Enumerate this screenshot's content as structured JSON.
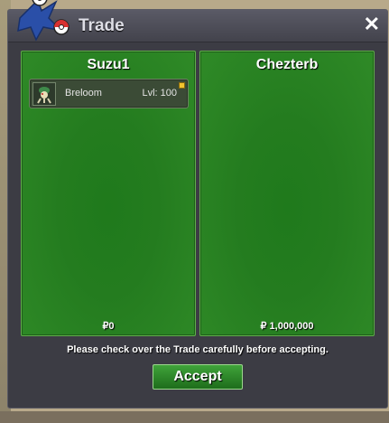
{
  "window": {
    "title": "Trade",
    "close_label": "✕"
  },
  "trade": {
    "left": {
      "name": "Suzu1",
      "money": "₽0",
      "items": [
        {
          "name": "Breloom",
          "level": "Lvl: 100"
        }
      ]
    },
    "right": {
      "name": "Chezterb",
      "money": "₽ 1,000,000",
      "items": []
    }
  },
  "notice": "Please check over the Trade carefully before accepting.",
  "accept_label": "Accept",
  "colors": {
    "panel_green": "#247c1f",
    "accept_green": "#2b8a27",
    "window_bg": "#3c3c44"
  },
  "icons": [
    "pokeball-logo-icon",
    "close-icon",
    "breloom-sprite-icon"
  ]
}
